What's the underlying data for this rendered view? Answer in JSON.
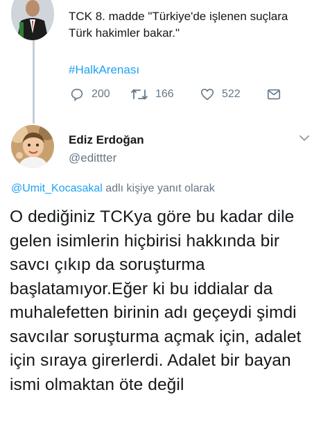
{
  "parent_tweet": {
    "text": "TCK 8. madde \"Türkiye'de işlenen suçlara Türk hakimler bakar.\"",
    "hashtag": "#HalkArenası",
    "actions": {
      "reply_count": "200",
      "retweet_count": "166",
      "like_count": "522"
    }
  },
  "reply_tweet": {
    "display_name": "Ediz Erdoğan",
    "handle": "@edittter",
    "reply_context": {
      "mention": "@Umit_Kocasakal",
      "suffix": " adlı kişiye yanıt olarak"
    },
    "text": "O dediğiniz TCKya göre bu kadar dile gelen isimlerin hiçbirisi hakkında bir savcı çıkıp da soruşturma başlatamıyor.Eğer ki bu iddialar da muhalefetten birinin adı geçeydi şimdi savcılar soruşturma açmak için, adalet için sıraya girerlerdi. Adalet bir bayan ismi olmaktan öte değil"
  },
  "colors": {
    "accent": "#1da1f2",
    "muted": "#657786",
    "text": "#14171a",
    "thread_line": "#c4cfd6"
  },
  "icons": [
    "reply-icon",
    "retweet-icon",
    "like-icon",
    "direct-message-icon",
    "chevron-down-icon"
  ]
}
